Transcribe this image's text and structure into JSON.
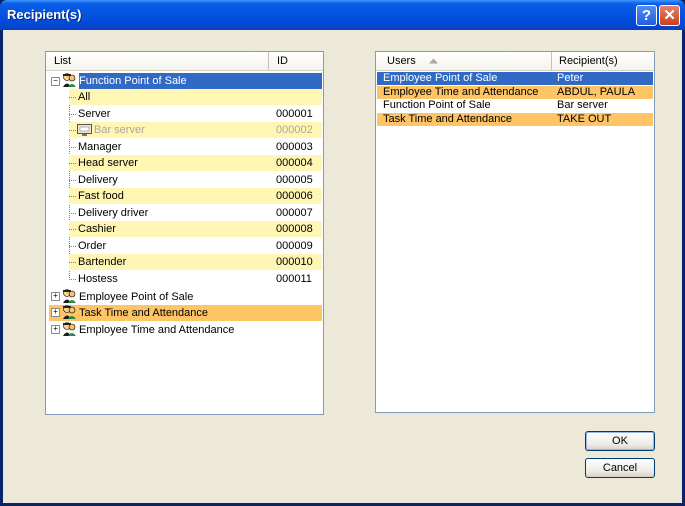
{
  "window": {
    "title": "Recipient(s)"
  },
  "titlebar": {
    "help_label": "?",
    "close_label": "✕"
  },
  "left_list": {
    "columns": {
      "list": "List",
      "id": "ID"
    },
    "groups": [
      {
        "label": "Function Point of Sale",
        "expanded": true,
        "selected": true
      },
      {
        "label": "Employee Point of Sale",
        "expanded": false
      },
      {
        "label": "Task Time and Attendance",
        "expanded": false,
        "highlight": "orange"
      },
      {
        "label": "Employee Time and Attendance",
        "expanded": false
      }
    ],
    "items": [
      {
        "name": "All",
        "id": "",
        "highlight": "yellow"
      },
      {
        "name": "Server",
        "id": "000001"
      },
      {
        "name": "Bar server",
        "id": "000002",
        "highlight": "yellow",
        "disabled": true
      },
      {
        "name": "Manager",
        "id": "000003"
      },
      {
        "name": "Head server",
        "id": "000004",
        "highlight": "yellow"
      },
      {
        "name": "Delivery",
        "id": "000005"
      },
      {
        "name": "Fast food",
        "id": "000006",
        "highlight": "yellow"
      },
      {
        "name": "Delivery driver",
        "id": "000007"
      },
      {
        "name": "Cashier",
        "id": "000008",
        "highlight": "yellow"
      },
      {
        "name": "Order",
        "id": "000009"
      },
      {
        "name": "Bartender",
        "id": "000010",
        "highlight": "yellow"
      },
      {
        "name": "Hostess",
        "id": "000011"
      }
    ],
    "expander_collapsed": "+",
    "expander_expanded": "−"
  },
  "right_list": {
    "columns": {
      "users": "Users",
      "recipients": "Recipient(s)",
      "sort_icon": "sort-up-icon"
    },
    "rows": [
      {
        "user": "Employee Point of Sale",
        "recipient": "Peter",
        "highlight": "blue"
      },
      {
        "user": "Employee Time and Attendance",
        "recipient": "ABDUL, PAULA",
        "highlight": "orange"
      },
      {
        "user": "Function Point of Sale",
        "recipient": "Bar server"
      },
      {
        "user": "Task Time and Attendance",
        "recipient": "TAKE OUT",
        "highlight": "orange"
      }
    ]
  },
  "buttons": {
    "ok": "OK",
    "cancel": "Cancel"
  },
  "colors": {
    "yellow": "#fff6b4",
    "orange": "#ffc466",
    "selection": "#316ac5"
  }
}
